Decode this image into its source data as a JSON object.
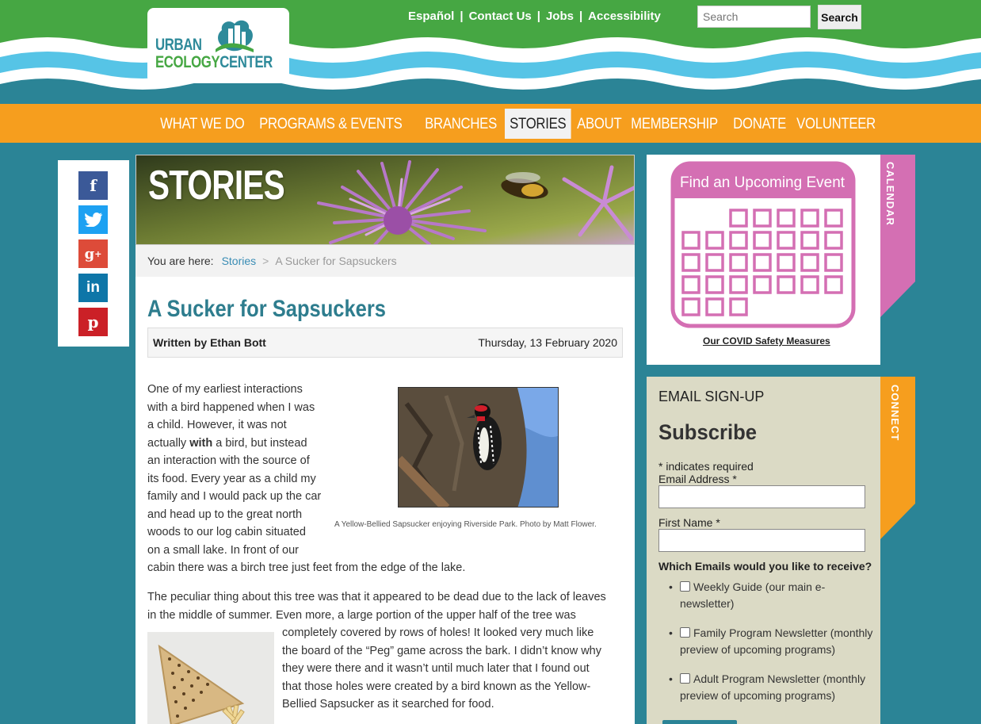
{
  "logo": {
    "line1": "URBAN",
    "line2a": "ECOLOGY",
    "line2b": "CENTER"
  },
  "top_links": [
    "Español",
    "Contact Us",
    "Jobs",
    "Accessibility"
  ],
  "search": {
    "placeholder": "Search",
    "button": "Search"
  },
  "nav": {
    "items": [
      "WHAT WE DO",
      "PROGRAMS & EVENTS",
      "BRANCHES",
      "STORIES",
      "ABOUT",
      "MEMBERSHIP",
      "DONATE",
      "VOLUNTEER"
    ],
    "active": "STORIES"
  },
  "social": [
    "facebook",
    "twitter",
    "google-plus",
    "linkedin",
    "pinterest"
  ],
  "banner": {
    "title": "STORIES"
  },
  "breadcrumb": {
    "prefix": "You are here:",
    "link": "Stories",
    "separator": ">",
    "current": "A Sucker for Sapsuckers"
  },
  "article": {
    "title": "A Sucker for Sapsuckers",
    "author": "Written by Ethan Bott",
    "date": "Thursday, 13 February 2020",
    "p1_lines": [
      "One of my earliest interactions",
      "with a bird happened when I was",
      "a child. However, it was not",
      "actually |with| a bird, but instead",
      "an interaction with the source of",
      "its food. Every year as a child my",
      "family and I would pack up the car",
      "and head up to the great north",
      "woods to our log cabin situated",
      "on a small lake. In front of our",
      "cabin there was a birch tree just feet from the edge of the lake."
    ],
    "p2_lines": [
      "The peculiar thing about this tree was that it appeared to be dead due to the lack of leaves",
      "in the middle of summer. Even more, a large portion of the upper half of the tree was",
      "completely covered by rows of holes!  It looked very much like",
      "the board of the “Peg” game across the bark. I didn’t know why",
      "they were there and it wasn’t until much later that I found out",
      "that those holes were created by a bird known as the Yellow-",
      "Bellied Sapsucker as it searched for food."
    ],
    "p1_bold_word": "with",
    "caption": "A Yellow-Bellied Sapsucker enjoying Riverside Park. Photo by Matt Flower."
  },
  "calendar": {
    "heading": "Find an Upcoming Event",
    "tab": "CALENDAR",
    "covid_link": "Our COVID Safety Measures"
  },
  "email": {
    "tab": "CONNECT",
    "heading": "EMAIL SIGN-UP",
    "subscribe": "Subscribe",
    "required_note": "* indicates required",
    "email_label": "Email Address *",
    "first_name_label": "First Name *",
    "question": "Which Emails would you like to receive?",
    "options": [
      {
        "line1": "Weekly Guide (our main e-",
        "line2": "newsletter)"
      },
      {
        "line1": "Family Program Newsletter (monthly",
        "line2": "preview of upcoming programs)"
      },
      {
        "line1": "Adult Program Newsletter (monthly",
        "line2": "preview of upcoming programs)"
      }
    ]
  },
  "colors": {
    "green": "#46a743",
    "teal": "#2b8496",
    "orange": "#f69e1e",
    "pink": "#d46fb3",
    "beige": "#dbdac5"
  }
}
